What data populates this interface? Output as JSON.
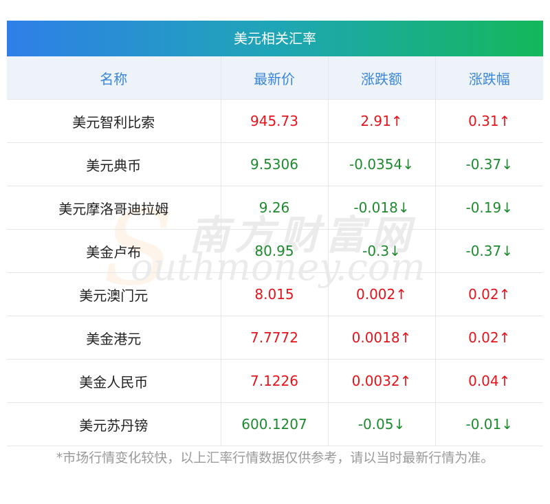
{
  "title": "美元相关汇率",
  "headers": [
    "名称",
    "最新价",
    "涨跌额",
    "涨跌幅"
  ],
  "rows": [
    {
      "name": "美元智利比索",
      "price": "945.73",
      "change": "2.91↑",
      "pct": "0.31↑",
      "dir": "up"
    },
    {
      "name": "美元典币",
      "price": "9.5306",
      "change": "-0.0354↓",
      "pct": "-0.37↓",
      "dir": "down"
    },
    {
      "name": "美元摩洛哥迪拉姆",
      "price": "9.26",
      "change": "-0.018↓",
      "pct": "-0.19↓",
      "dir": "down"
    },
    {
      "name": "美金卢布",
      "price": "80.95",
      "change": "-0.3↓",
      "pct": "-0.37↓",
      "dir": "down"
    },
    {
      "name": "美元澳门元",
      "price": "8.015",
      "change": "0.002↑",
      "pct": "0.02↑",
      "dir": "up"
    },
    {
      "name": "美金港元",
      "price": "7.7772",
      "change": "0.0018↑",
      "pct": "0.02↑",
      "dir": "up"
    },
    {
      "name": "美金人民币",
      "price": "7.1226",
      "change": "0.0032↑",
      "pct": "0.04↑",
      "dir": "up"
    },
    {
      "name": "美元苏丹镑",
      "price": "600.1207",
      "change": "-0.05↓",
      "pct": "-0.01↓",
      "dir": "down"
    }
  ],
  "note": "*市场行情变化较快，以上汇率行情数据仅供参考，请以当时最新行情为准。",
  "watermark": {
    "cn": "南方财富网",
    "en": "outhmoney.com",
    "s": "S"
  },
  "colors": {
    "up": "#e3141b",
    "down": "#1e8a2e",
    "header_text": "#3a86d8"
  }
}
